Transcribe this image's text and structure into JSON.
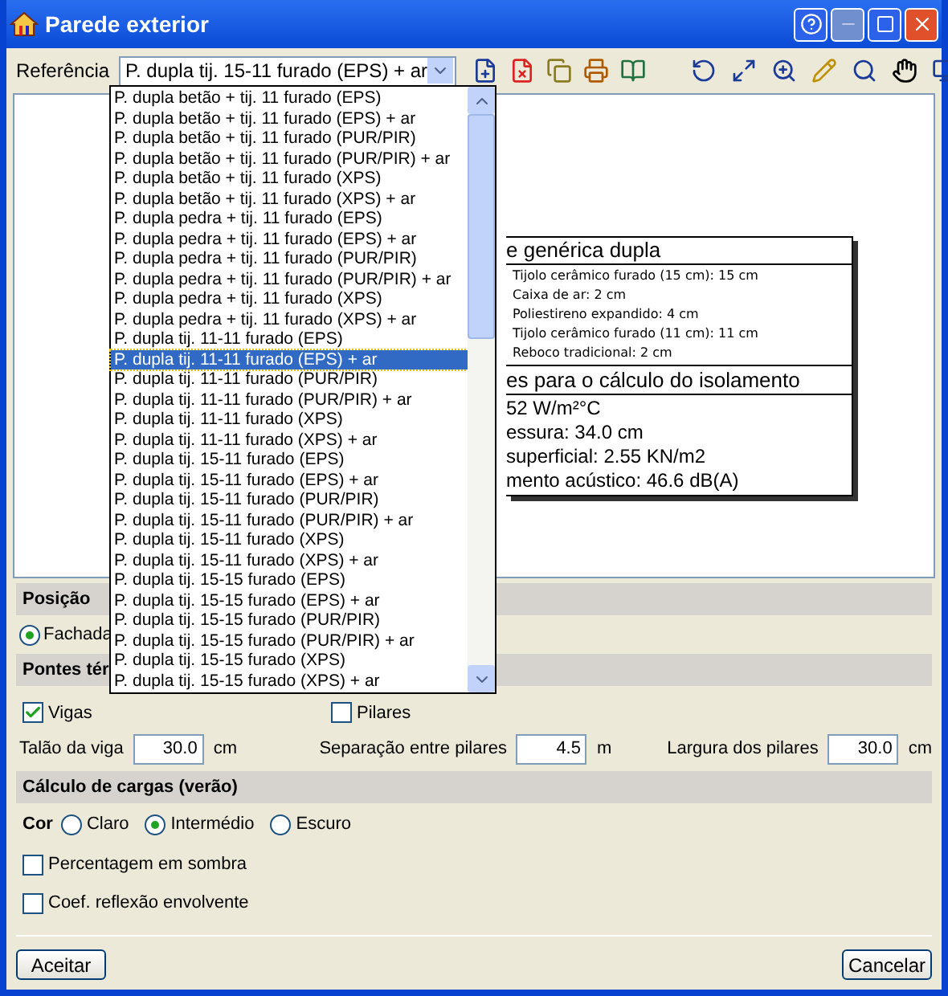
{
  "window": {
    "title": "Parede exterior"
  },
  "reference": {
    "label": "Referência",
    "value": "P. dupla tij. 15-11 furado (EPS) + ar"
  },
  "dropdown": {
    "items": [
      {
        "label": "P. dupla betão + tij. 11 furado (EPS)",
        "selected": false
      },
      {
        "label": "P. dupla betão + tij. 11 furado (EPS) + ar",
        "selected": false
      },
      {
        "label": "P. dupla betão + tij. 11 furado (PUR/PIR)",
        "selected": false
      },
      {
        "label": "P. dupla betão + tij. 11 furado (PUR/PIR) + ar",
        "selected": false
      },
      {
        "label": "P. dupla betão + tij. 11 furado (XPS)",
        "selected": false
      },
      {
        "label": "P. dupla betão + tij. 11 furado (XPS) + ar",
        "selected": false
      },
      {
        "label": "P. dupla pedra + tij. 11 furado (EPS)",
        "selected": false
      },
      {
        "label": "P. dupla pedra + tij. 11 furado (EPS) + ar",
        "selected": false
      },
      {
        "label": "P. dupla pedra + tij. 11 furado (PUR/PIR)",
        "selected": false
      },
      {
        "label": "P. dupla pedra + tij. 11 furado (PUR/PIR) + ar",
        "selected": false
      },
      {
        "label": "P. dupla pedra + tij. 11 furado (XPS)",
        "selected": false
      },
      {
        "label": "P. dupla pedra + tij. 11 furado (XPS) + ar",
        "selected": false
      },
      {
        "label": "P. dupla tij. 11-11 furado (EPS)",
        "selected": false
      },
      {
        "label": "P. dupla tij. 11-11 furado (EPS) + ar",
        "selected": true
      },
      {
        "label": "P. dupla tij. 11-11 furado (PUR/PIR)",
        "selected": false
      },
      {
        "label": "P. dupla tij. 11-11 furado (PUR/PIR) + ar",
        "selected": false
      },
      {
        "label": "P. dupla tij. 11-11 furado (XPS)",
        "selected": false
      },
      {
        "label": "P. dupla tij. 11-11 furado (XPS) + ar",
        "selected": false
      },
      {
        "label": "P. dupla tij. 15-11 furado (EPS)",
        "selected": false
      },
      {
        "label": "P. dupla tij. 15-11 furado (EPS) + ar",
        "selected": false
      },
      {
        "label": "P. dupla tij. 15-11 furado (PUR/PIR)",
        "selected": false
      },
      {
        "label": "P. dupla tij. 15-11 furado (PUR/PIR) + ar",
        "selected": false
      },
      {
        "label": "P. dupla tij. 15-11 furado (XPS)",
        "selected": false
      },
      {
        "label": "P. dupla tij. 15-11 furado (XPS) + ar",
        "selected": false
      },
      {
        "label": "P. dupla tij. 15-15 furado (EPS)",
        "selected": false
      },
      {
        "label": "P. dupla tij. 15-15 furado (EPS) + ar",
        "selected": false
      },
      {
        "label": "P. dupla tij. 15-15 furado (PUR/PIR)",
        "selected": false
      },
      {
        "label": "P. dupla tij. 15-15 furado (PUR/PIR) + ar",
        "selected": false
      },
      {
        "label": "P. dupla tij. 15-15 furado (XPS)",
        "selected": false
      },
      {
        "label": "P. dupla tij. 15-15 furado (XPS) + ar",
        "selected": false
      }
    ]
  },
  "preview": {
    "title": "e genérica dupla",
    "layers": [
      "Tijolo cerâmico furado (15 cm): 15 cm",
      "Caixa de ar: 2 cm",
      "Poliestireno expandido: 4 cm",
      "Tijolo cerâmico furado (11 cm): 11 cm",
      "Reboco tradicional: 2 cm"
    ],
    "section_title": "es para o cálculo do isolamento",
    "properties": [
      "52 W/m²°C",
      "essura: 34.0 cm",
      "superficial: 2.55 KN/m2",
      "mento acústico: 46.6 dB(A)"
    ]
  },
  "position": {
    "title": "Posição",
    "options": [
      {
        "label": "Fachada",
        "selected": true
      }
    ]
  },
  "bridges": {
    "title": "Pontes tér",
    "checks": [
      {
        "label": "Vigas",
        "checked": true
      },
      {
        "label": "Pilares",
        "checked": false
      }
    ],
    "fields": [
      {
        "label": "Talão da viga",
        "value": "30.0",
        "unit": "cm"
      },
      {
        "label": "Separação entre pilares",
        "value": "4.5",
        "unit": "m"
      },
      {
        "label": "Largura dos pilares",
        "value": "30.0",
        "unit": "cm"
      }
    ]
  },
  "loads": {
    "title": "Cálculo de cargas (verão)",
    "color_label": "Cor",
    "colors": [
      {
        "label": "Claro",
        "selected": false
      },
      {
        "label": "Intermédio",
        "selected": true
      },
      {
        "label": "Escuro",
        "selected": false
      }
    ],
    "checks": [
      {
        "label": "Percentagem em sombra",
        "checked": false
      },
      {
        "label": "Coef. reflexão envolvente",
        "checked": false
      }
    ]
  },
  "buttons": [
    "Aceitar",
    "Cancelar"
  ]
}
